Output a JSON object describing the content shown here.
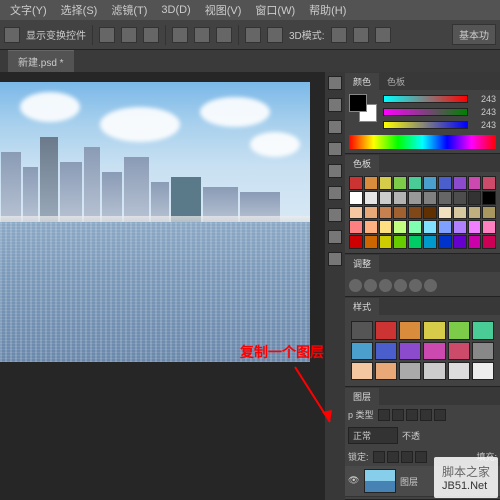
{
  "menu": {
    "items": [
      "文字(Y)",
      "选择(S)",
      "滤镜(T)",
      "3D(D)",
      "视图(V)",
      "窗口(W)",
      "帮助(H)"
    ]
  },
  "options": {
    "label1": "显示变换控件",
    "label2": "3D模式:",
    "right_button": "基本功"
  },
  "tab": {
    "label": "新建.psd *"
  },
  "color_panel": {
    "tab1": "颜色",
    "tab2": "色板",
    "val1": "243",
    "val2": "243",
    "val3": "243"
  },
  "swatches_panel": {
    "tab": "色板"
  },
  "styles_panel": {
    "tab": "样式"
  },
  "adjustments_panel": {
    "tab": "调整"
  },
  "layers_panel": {
    "tab1": "图层",
    "kind_label": "p 类型",
    "blend": "正常",
    "opacity_label": "不透",
    "lock_label": "锁定:",
    "fill_label": "填充:",
    "layer1_name": "图层"
  },
  "annotation": {
    "text": "复制一个图层"
  },
  "watermark": {
    "line1": "脚本之家",
    "line2": "JB51.Net"
  },
  "swatch_colors": [
    "#cc3333",
    "#d98c3b",
    "#d6cc4a",
    "#7ccc4a",
    "#4acc97",
    "#4a9fcc",
    "#4a5fcc",
    "#8c4acc",
    "#cc4ab0",
    "#cc4a6a",
    "#ffffff",
    "#e6e6e6",
    "#cccccc",
    "#b3b3b3",
    "#999999",
    "#808080",
    "#666666",
    "#4d4d4d",
    "#333333",
    "#000000",
    "#f4c7a0",
    "#e8a878",
    "#c78050",
    "#a06030",
    "#804818",
    "#603000",
    "#f0e0c0",
    "#d8c8a0",
    "#c0b080",
    "#a89860",
    "#ff8080",
    "#ffb080",
    "#ffe080",
    "#c0ff80",
    "#80ffb0",
    "#80e0ff",
    "#80a0ff",
    "#b080ff",
    "#f080ff",
    "#ff80c0",
    "#cc0000",
    "#cc6600",
    "#cccc00",
    "#66cc00",
    "#00cc66",
    "#0099cc",
    "#0033cc",
    "#6600cc",
    "#cc00aa",
    "#cc0055"
  ],
  "style_colors": [
    "#555",
    "#cc3333",
    "#d98c3b",
    "#d6cc4a",
    "#7ccc4a",
    "#4acc97",
    "#4a9fcc",
    "#4a5fcc",
    "#8c4acc",
    "#cc4ab0",
    "#cc4a6a",
    "#888",
    "#f4c7a0",
    "#e8a878",
    "#aaa",
    "#ccc",
    "#ddd",
    "#eee"
  ]
}
